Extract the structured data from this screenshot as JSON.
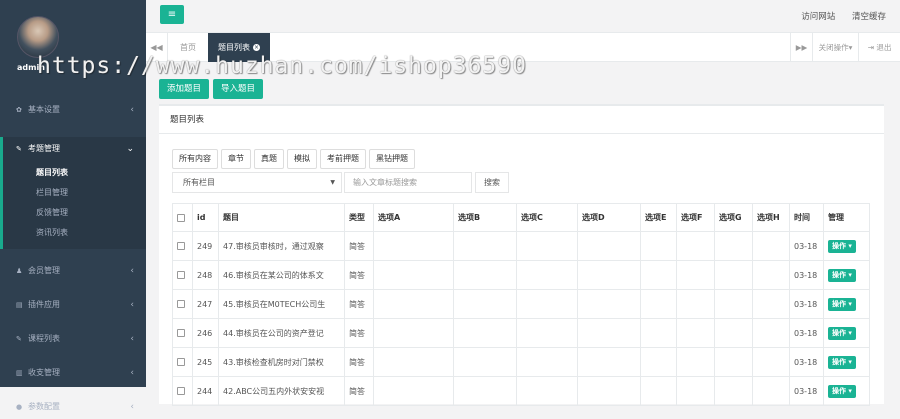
{
  "sidebar": {
    "admin_name": "admin",
    "menu": [
      {
        "icon": "gear-icon",
        "glyph": "✿",
        "label": "基本设置",
        "arrow": "‹"
      },
      {
        "icon": "edit-icon",
        "glyph": "✎",
        "label": "考题管理",
        "arrow": "⌄"
      },
      {
        "icon": "user-icon",
        "glyph": "♟",
        "label": "会员管理",
        "arrow": "‹"
      },
      {
        "icon": "plugin-icon",
        "glyph": "▤",
        "label": "插件应用",
        "arrow": "‹"
      },
      {
        "icon": "course-icon",
        "glyph": "✎",
        "label": "课程列表",
        "arrow": "‹"
      },
      {
        "icon": "chart-icon",
        "glyph": "▥",
        "label": "收支管理",
        "arrow": "‹"
      },
      {
        "icon": "config-icon",
        "glyph": "●",
        "label": "参数配置",
        "arrow": "‹"
      }
    ],
    "submenu": [
      "题目列表",
      "栏目管理",
      "反馈管理",
      "资讯列表"
    ]
  },
  "topbar": {
    "menu_icon": "≡",
    "links": [
      "访问网站",
      "清空缓存"
    ]
  },
  "tabs": {
    "back": "◀◀",
    "home": "首页",
    "current": "题目列表",
    "close": "×",
    "forward": "▶▶",
    "close_ops": "关闭操作▾",
    "logout": "⇥ 退出"
  },
  "actions": {
    "add": "添加题目",
    "import": "导入题目"
  },
  "panel": {
    "title": "题目列表"
  },
  "filters": [
    "所有内容",
    "章节",
    "真题",
    "模拟",
    "考前押题",
    "黑钻押题"
  ],
  "search": {
    "select": "所有栏目",
    "caret": "▼",
    "placeholder": "输入文章标题搜索",
    "button": "搜索"
  },
  "table": {
    "headers": [
      "",
      "id",
      "题目",
      "类型",
      "选项A",
      "选项B",
      "选项C",
      "选项D",
      "选项E",
      "选项F",
      "选项G",
      "选项H",
      "时间",
      "管理"
    ],
    "rows": [
      {
        "id": "249",
        "title": "47.审核员审核时，通过观察",
        "type": "简答",
        "time": "03-18",
        "op": "操作 ▾"
      },
      {
        "id": "248",
        "title": "46.审核员在某公司的体系文",
        "type": "简答",
        "time": "03-18",
        "op": "操作 ▾"
      },
      {
        "id": "247",
        "title": "45.审核员在M0TECH公司生",
        "type": "简答",
        "time": "03-18",
        "op": "操作 ▾"
      },
      {
        "id": "246",
        "title": "44.审核员在公司的资产登记",
        "type": "简答",
        "time": "03-18",
        "op": "操作 ▾"
      },
      {
        "id": "245",
        "title": "43.审核检查机房时对门禁权",
        "type": "简答",
        "time": "03-18",
        "op": "操作 ▾"
      },
      {
        "id": "244",
        "title": "42.ABC公司五内外状安安视",
        "type": "简答",
        "time": "03-18",
        "op": "操作 ▾"
      }
    ]
  },
  "watermark": "https://www.huzhan.com/ishop36590",
  "colors": {
    "sidebar": "#2f4050",
    "accent": "#1ab394"
  }
}
